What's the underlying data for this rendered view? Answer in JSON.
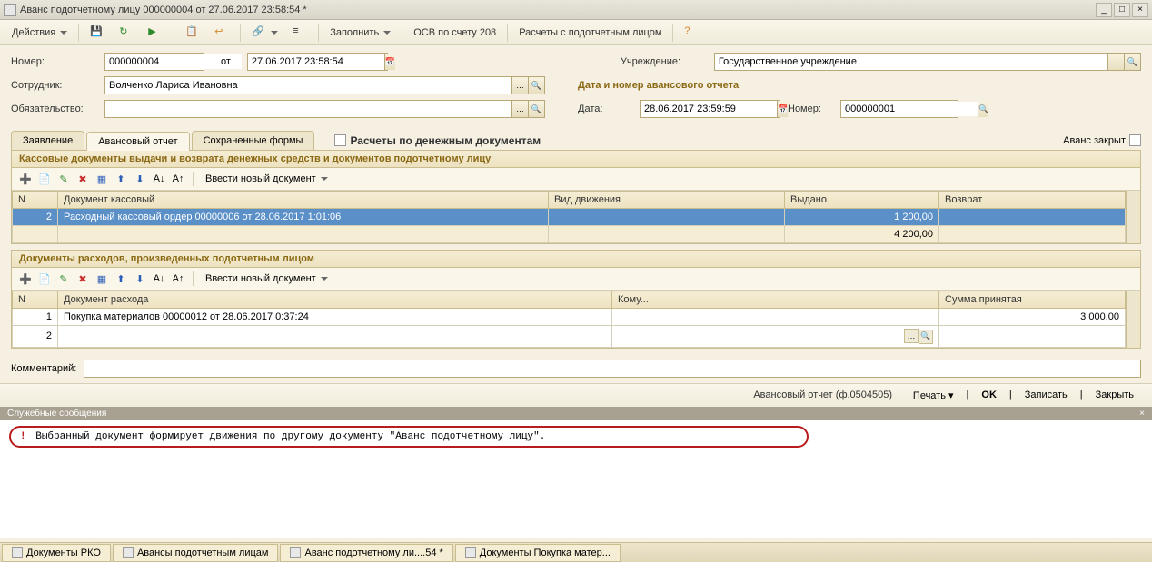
{
  "window": {
    "title": "Аванс подотчетному лицу 000000004 от 27.06.2017 23:58:54 *"
  },
  "toolbar": {
    "actions": "Действия",
    "fill": "Заполнить",
    "osv": "ОСВ по счету 208",
    "calc": "Расчеты с подотчетным лицом"
  },
  "form": {
    "number_label": "Номер:",
    "number_value": "000000004",
    "from_label": "от",
    "date_value": "27.06.2017 23:58:54",
    "org_label": "Учреждение:",
    "org_value": "Государственное учреждение",
    "employee_label": "Сотрудник:",
    "employee_value": "Волченко Лариса Ивановна",
    "advance_section": "Дата и номер авансового отчета",
    "obligation_label": "Обязательство:",
    "obligation_value": "",
    "date2_label": "Дата:",
    "date2_value": "28.06.2017 23:59:59",
    "number2_label": "Номер:",
    "number2_value": "000000001"
  },
  "tabs": {
    "t1": "Заявление",
    "t2": "Авансовый отчет",
    "t3": "Сохраненные формы",
    "checkbox": "Расчеты по денежным документам",
    "closed": "Аванс закрыт"
  },
  "panel1": {
    "title": "Кассовые документы выдачи и возврата денежных средств и документов подотчетному лицу",
    "new_doc": "Ввести новый документ",
    "col_n": "N",
    "col_doc": "Документ кассовый",
    "col_type": "Вид движения",
    "col_out": "Выдано",
    "col_ret": "Возврат",
    "row1_n": "2",
    "row1_doc": "Расходный кассовый ордер 00000006 от 28.06.2017 1:01:06",
    "row1_out": "1 200,00",
    "total_out": "4 200,00"
  },
  "panel2": {
    "title": "Документы расходов, произведенных подотчетным лицом",
    "new_doc": "Ввести новый документ",
    "col_n": "N",
    "col_doc": "Документ расхода",
    "col_who": "Кому...",
    "col_sum": "Сумма принятая",
    "row1_n": "1",
    "row1_doc": "Покупка материалов 00000012 от 28.06.2017 0:37:24",
    "row1_sum": "3 000,00",
    "row2_n": "2"
  },
  "comment": {
    "label": "Комментарий:"
  },
  "bottom": {
    "report": "Авансовый отчет (ф.0504505)",
    "print": "Печать",
    "ok": "OK",
    "save": "Записать",
    "close": "Закрыть"
  },
  "messages": {
    "header": "Служебные сообщения",
    "text": "Выбранный документ формирует движения по другому документу \"Аванс подотчетному лицу\"."
  },
  "statusbar": {
    "t1": "Документы РКО",
    "t2": "Авансы подотчетным лицам",
    "t3": "Аванс подотчетному ли....54 *",
    "t4": "Документы Покупка матер..."
  }
}
